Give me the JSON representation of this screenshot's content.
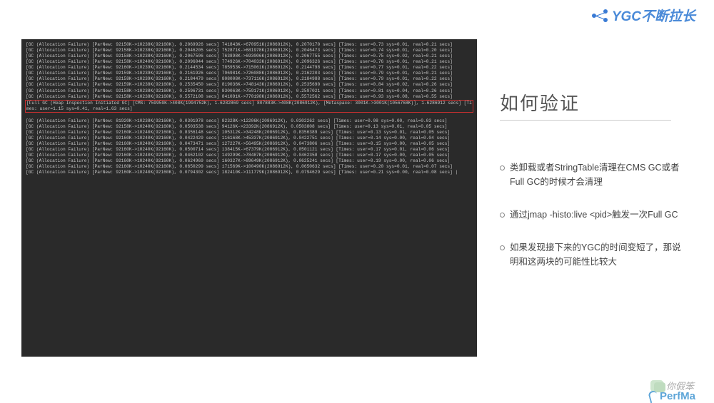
{
  "header": {
    "title": "YGC不断拉长"
  },
  "side": {
    "heading": "如何验证",
    "bullets": [
      "类卸载或者StringTable清理在CMS GC或者Full GC的时候才会清理",
      "通过jmap -histo:live <pid>触发一次Full GC",
      "如果发现接下来的YGC的时间变短了，那说明和这两块的可能性比较大"
    ]
  },
  "watermark": {
    "name": "你假笨",
    "logo": "PerfMa"
  },
  "terminal_highlight_index": 10,
  "terminal_lines": [
    "[GC (Allocation Failure) [ParNew: 92150K->10238K(92160K), 0.2069926 secs] 741843K->670951K(2086912K), 0.2070170 secs] [Times: user=0.73 sys=0.01, real=0.21 secs]",
    "[GC (Allocation Failure) [ParNew: 92158K->10238K(92160K), 0.2046205 secs] 752871K->681978K(2086912K), 0.2046473 secs] [Times: user=0.74 sys=0.01, real=0.20 secs]",
    "[GC (Allocation Failure) [ParNew: 92158K->10238K(92160K), 0.2067506 secs] 763898K->693006K(2086912K), 0.2067755 secs] [Times: user=0.75 sys=0.02, real=0.21 secs]",
    "[GC (Allocation Failure) [ParNew: 92158K->10240K(92160K), 0.2096044 secs] 774926K->704033K(2086912K), 0.2096326 secs] [Times: user=0.76 sys=0.01, real=0.21 secs]",
    "[GC (Allocation Failure) [ParNew: 92160K->10239K(92160K), 0.2144534 secs] 785953K->715061K(2086912K), 0.2144798 secs] [Times: user=0.77 sys=0.01, real=0.22 secs]",
    "[GC (Allocation Failure) [ParNew: 92159K->10239K(92160K), 0.2161926 secs] 796981K->726088K(2086912K), 0.2162203 secs] [Times: user=0.79 sys=0.01, real=0.21 secs]",
    "[GC (Allocation Failure) [ParNew: 92159K->10239K(92160K), 0.2184479 secs] 808008K->737116K(2086912K), 0.2184988 secs] [Times: user=0.79 sys=0.01, real=0.22 secs]",
    "[GC (Allocation Failure) [ParNew: 92159K->10238K(92160K), 0.2535450 secs] 819036K->748143K(2086912K), 0.2535690 secs] [Times: user=0.84 sys=0.02, real=0.26 secs]",
    "[GC (Allocation Failure) [ParNew: 92158K->10238K(92160K), 0.2596731 secs] 830063K->759171K(2086912K), 0.2597021 secs] [Times: user=0.81 sys=0.04, real=0.26 secs]",
    "[GC (Allocation Failure) [ParNew: 92158K->10238K(92160K), 0.5572108 secs] 841091K->770198K(2086912K), 0.5572562 secs] [Times: user=0.93 sys=0.08, real=0.55 secs]",
    "[Full GC (Heap Inspection Initiated GC) [CMS: 759959K->408K(1994752K), 1.6282869 secs] 807883K->408K(2086912K), [Metaspace: 3001K->3001K(1056768K)], 1.6286912 secs] [Times: user=1.15 sys=0.41, real=1.63 secs]",
    "[GC (Allocation Failure) [ParNew: 81920K->10238K(92160K), 0.0301978 secs] 82328K->12206K(2086912K), 0.0302262 secs] [Times: user=0.08 sys=0.00, real=0.03 secs]",
    "[GC (Allocation Failure) [ParNew: 92158K->10240K(92160K), 0.0503538 secs] 94126K->23392K(2086912K), 0.0503808 secs] [Times: user=0.13 sys=0.01, real=0.05 secs]",
    "[GC (Allocation Failure) [ParNew: 92160K->10240K(92160K), 0.8356148 secs] 105312K->34248K(2086912K), 0.8356389 secs] [Times: user=0.13 sys=0.01, real=0.05 secs]",
    "[GC (Allocation Failure) [ParNew: 92160K->10240K(92160K), 0.0422429 secs] 116168K->45337K(2086912K), 0.0422751 secs] [Times: user=0.14 sys=0.00, real=0.04 secs]",
    "[GC (Allocation Failure) [ParNew: 92160K->10240K(92160K), 0.0473471 secs] 127227K->56495K(2086912K), 0.0473806 secs] [Times: user=0.15 sys=0.00, real=0.05 secs]",
    "[GC (Allocation Failure) [ParNew: 92160K->10240K(92160K), 0.0500714 secs] 138415K->67379K(2086912K), 0.0501121 secs] [Times: user=0.17 sys=0.01, real=0.06 secs]",
    "[GC (Allocation Failure) [ParNew: 92160K->10240K(92160K), 0.0462102 secs] 149299K->78487K(2086912K), 0.0462358 secs] [Times: user=0.17 sys=0.00, real=0.05 secs]",
    "[GC (Allocation Failure) [ParNew: 92160K->10240K(92160K), 0.0624969 secs] 160327K->89649K(2086912K), 0.0625241 secs] [Times: user=0.19 sys=0.00, real=0.06 secs]",
    "[GC (Allocation Failure) [ParNew: 92160K->10240K(92160K), 0.0650299 secs] 171569K->100490K(2086912K), 0.0650632 secs] [Times: user=0.20 sys=0.01, real=0.07 secs]",
    "[GC (Allocation Failure) [ParNew: 92160K->10240K(92160K), 0.0794302 secs] 182410K->111779K(2086912K), 0.0794629 secs] [Times: user=0.21 sys=0.00, real=0.08 secs] |"
  ]
}
